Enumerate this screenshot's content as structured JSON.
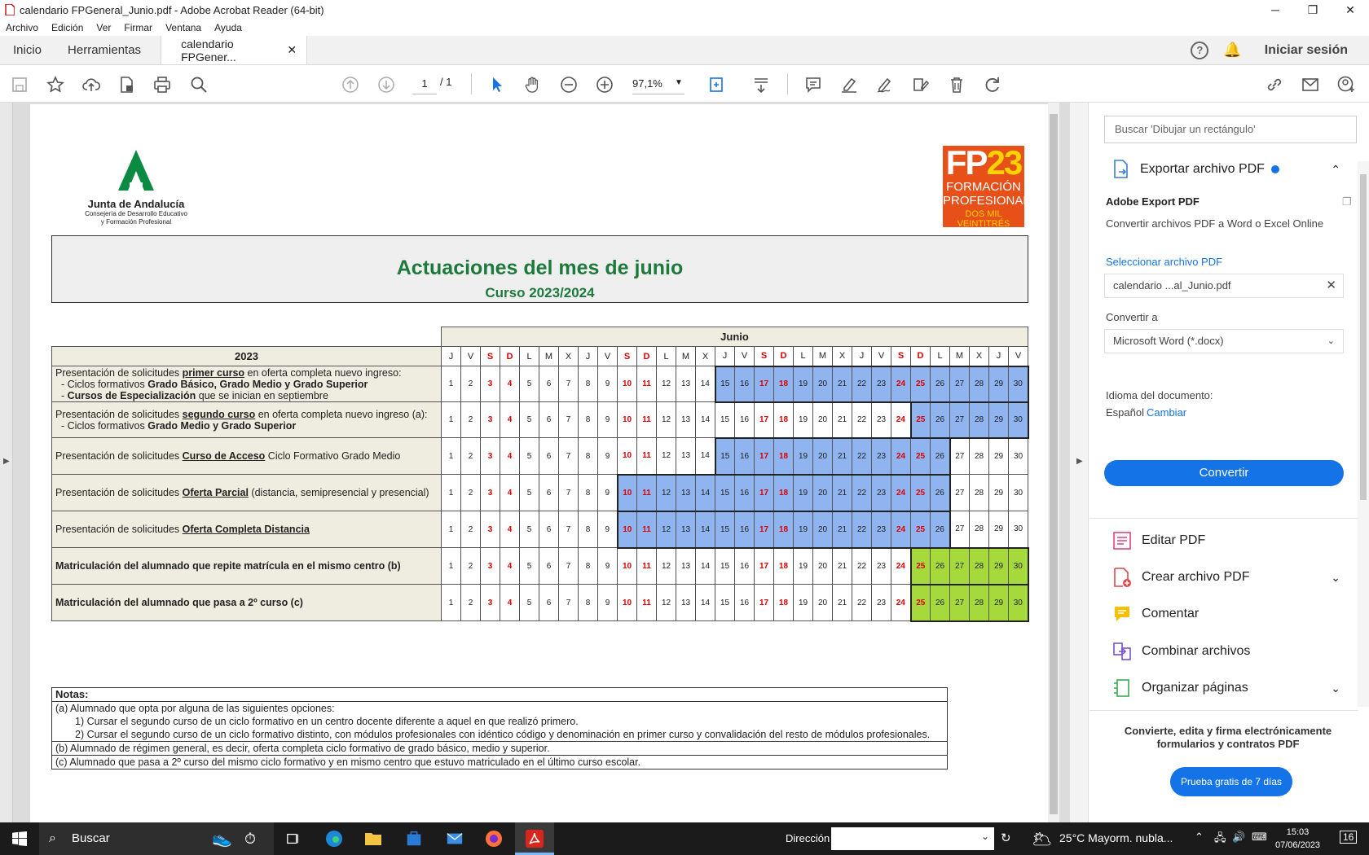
{
  "window": {
    "title": "calendario FPGeneral_Junio.pdf - Adobe Acrobat Reader (64-bit)"
  },
  "menu": [
    "Archivo",
    "Edición",
    "Ver",
    "Firmar",
    "Ventana",
    "Ayuda"
  ],
  "tabs": {
    "home": "Inicio",
    "tools": "Herramientas",
    "doc": "calendario FPGener...",
    "signin": "Iniciar sesión"
  },
  "toolbar": {
    "page": "1",
    "total": "/ 1",
    "zoom": "97,1%"
  },
  "doc": {
    "logo_ja": {
      "name": "Junta de Andalucía",
      "sub1": "Consejería de Desarrollo Educativo",
      "sub2": "y Formación Profesional"
    },
    "logo_fp": {
      "big": "FP",
      "num": "23",
      "l1": "FORMACIÓN",
      "l2": "PROFESIONAL",
      "l3": "DOS MIL VEINTITRÉS"
    },
    "title": "Actuaciones del mes de junio",
    "subtitle": "Curso 2023/2024",
    "month": "Junio",
    "year": "2023",
    "weekdays": [
      "J",
      "V",
      "S",
      "D",
      "L",
      "M",
      "X",
      "J",
      "V",
      "S",
      "D",
      "L",
      "M",
      "X",
      "J",
      "V",
      "S",
      "D",
      "L",
      "M",
      "X",
      "J",
      "V",
      "S",
      "D",
      "L",
      "M",
      "X",
      "J",
      "V"
    ],
    "weekend_days": [
      3,
      4,
      10,
      11,
      17,
      18,
      24,
      25
    ],
    "rows": [
      {
        "parts": [
          [
            "Presentación de solicitudes ",
            ""
          ],
          [
            "primer curso",
            "u"
          ],
          [
            " en oferta completa nuevo ingreso:",
            ""
          ]
        ],
        "lines": [
          [
            [
              "  - Ciclos formativos ",
              ""
            ],
            [
              "Grado Básico, Grado Medio y Grado Superior",
              "b"
            ]
          ],
          [
            [
              "  - ",
              ""
            ],
            [
              "Cursos de Especialización",
              "b"
            ],
            [
              " que se inician en septiembre",
              ""
            ]
          ]
        ],
        "color": "blue",
        "from": 15,
        "to": 30
      },
      {
        "parts": [
          [
            "Presentación de solicitudes ",
            ""
          ],
          [
            "segundo curso",
            "u"
          ],
          [
            " en oferta completa nuevo ingreso (a):",
            ""
          ]
        ],
        "lines": [
          [
            [
              "  - Ciclos formativos ",
              ""
            ],
            [
              "Grado Medio y Grado Superior",
              "b"
            ]
          ]
        ],
        "color": "blue",
        "from": 25,
        "to": 30
      },
      {
        "parts": [
          [
            "Presentación de solicitudes ",
            ""
          ],
          [
            "Curso de Acceso",
            "u"
          ],
          [
            " Ciclo Formativo Grado Medio",
            ""
          ]
        ],
        "lines": [],
        "color": "blue",
        "from": 15,
        "to": 26
      },
      {
        "parts": [
          [
            "Presentación de solicitudes ",
            ""
          ],
          [
            "Oferta Parcial",
            "u"
          ],
          [
            " (distancia, semipresencial y presencial)",
            ""
          ]
        ],
        "lines": [],
        "color": "blue",
        "from": 10,
        "to": 26
      },
      {
        "parts": [
          [
            "Presentación de solicitudes ",
            ""
          ],
          [
            "Oferta Completa Distancia",
            "u"
          ]
        ],
        "lines": [],
        "color": "blue",
        "from": 10,
        "to": 26
      },
      {
        "parts": [
          [
            "Matriculación del alumnado que repite matrícula en el mismo centro (b)",
            "b"
          ]
        ],
        "lines": [],
        "color": "green",
        "from": 25,
        "to": 30
      },
      {
        "parts": [
          [
            "Matriculación del alumnado que pasa a 2º curso (c)",
            "b"
          ]
        ],
        "lines": [],
        "color": "green",
        "from": 25,
        "to": 30
      }
    ],
    "notes": {
      "title": "Notas:",
      "a": "(a) Alumnado que opta por alguna de las siguientes opciones:",
      "a1": "1) Cursar el segundo curso de un ciclo formativo en un centro docente diferente a aquel en que realizó primero.",
      "a2": "2) Cursar el segundo curso de un ciclo formativo distinto, con módulos profesionales con idéntico código y denominación en primer curso y convalidación del resto de módulos profesionales.",
      "b": "(b) Alumnado de régimen general, es decir, oferta completa ciclo formativo de grado básico, medio y superior.",
      "c": "(c) Alumnado que pasa a 2º curso del mismo ciclo formativo y en mismo centro que estuvo matriculado en el último curso escolar."
    }
  },
  "panel": {
    "search_placeholder": "Buscar 'Dibujar un rectángulo'",
    "export": "Exportar archivo PDF",
    "export_title": "Adobe Export PDF",
    "export_desc": "Convertir archivos PDF a Word o Excel Online",
    "select_file": "Seleccionar archivo PDF",
    "file": "calendario ...al_Junio.pdf",
    "convert_to": "Convertir a",
    "format": "Microsoft Word (*.docx)",
    "lang_label": "Idioma del documento:",
    "lang": "Español",
    "change": "Cambiar",
    "convert_btn": "Convertir",
    "tools": [
      "Editar PDF",
      "Crear archivo PDF",
      "Comentar",
      "Combinar archivos",
      "Organizar páginas"
    ],
    "promo": "Convierte, edita y firma electrónicamente formularios y contratos PDF",
    "trial": "Prueba gratis de 7 días"
  },
  "taskbar": {
    "search": "Buscar",
    "address": "Dirección",
    "weather": "25°C  Mayorm. nubla...",
    "time": "15:03",
    "date": "07/06/2023",
    "notif": "16"
  }
}
